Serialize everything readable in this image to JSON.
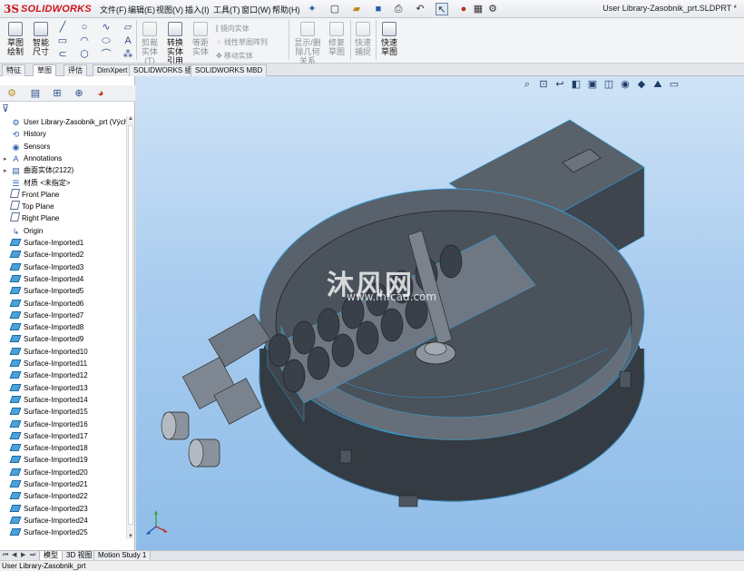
{
  "app": {
    "logo_ds": "3S",
    "logo_brand": "SOLIDWORKS",
    "document_title": "User Library-Zasobnik_prt.SLDPRT *"
  },
  "menu": [
    "文件(F)",
    "编辑(E)",
    "视图(V)",
    "插入(I)",
    "工具(T)",
    "窗口(W)",
    "帮助(H)"
  ],
  "ribbon": {
    "sketch": "草图绘制",
    "smart_dim": "智能尺寸",
    "trim": "剪裁实体(T)",
    "convert": "转换实体引用",
    "offset": "等距实体",
    "mirror": "镜向实体",
    "linear_pattern": "线性草图阵列",
    "move": "移动实体",
    "display_delete": "显示/删除几何关系",
    "repair": "修复草图",
    "quick_snap": "快速捕捉",
    "rapid_sketch": "快速草图"
  },
  "tabs": [
    "特征",
    "草图",
    "评估",
    "DimXpert",
    "SOLIDWORKS 插件",
    "SOLIDWORKS MBD"
  ],
  "active_tab_index": 1,
  "tree": {
    "root": "User Library-Zasobnik_prt  (Výchoz",
    "items": [
      {
        "label": "History",
        "icon": "history-icon",
        "expand": ""
      },
      {
        "label": "Sensors",
        "icon": "sensors-icon",
        "expand": ""
      },
      {
        "label": "Annotations",
        "icon": "annotations-icon",
        "expand": "▸"
      },
      {
        "label": "曲面实体(2122)",
        "icon": "surface-bodies-icon",
        "expand": "▸"
      },
      {
        "label": "材质 <未指定>",
        "icon": "material-icon",
        "expand": ""
      },
      {
        "label": "Front Plane",
        "icon": "plane-icon",
        "expand": ""
      },
      {
        "label": "Top Plane",
        "icon": "plane-icon",
        "expand": ""
      },
      {
        "label": "Right Plane",
        "icon": "plane-icon",
        "expand": ""
      },
      {
        "label": "Origin",
        "icon": "origin-icon",
        "expand": ""
      }
    ],
    "surfaces": [
      "Surface-Imported1",
      "Surface-Imported2",
      "Surface-Imported3",
      "Surface-Imported4",
      "Surface-Imported5",
      "Surface-Imported6",
      "Surface-Imported7",
      "Surface-Imported8",
      "Surface-Imported9",
      "Surface-Imported10",
      "Surface-Imported11",
      "Surface-Imported12",
      "Surface-Imported13",
      "Surface-Imported14",
      "Surface-Imported15",
      "Surface-Imported16",
      "Surface-Imported17",
      "Surface-Imported18",
      "Surface-Imported19",
      "Surface-Imported20",
      "Surface-Imported21",
      "Surface-Imported22",
      "Surface-Imported23",
      "Surface-Imported24",
      "Surface-Imported25"
    ]
  },
  "watermark": {
    "text": "沐风网",
    "url": "www.mfcad.com"
  },
  "bottom_tabs": [
    "模型",
    "3D 视图",
    "Motion Study 1"
  ],
  "active_bottom_tab_index": 0,
  "status": "User Library-Zasobnik_prt",
  "colors": {
    "viewport_top": "#cfe3f6",
    "viewport_bottom": "#8fbde8",
    "model_body": "#4d5560",
    "model_edge": "#2fa3e0",
    "brand": "#d0151a"
  }
}
